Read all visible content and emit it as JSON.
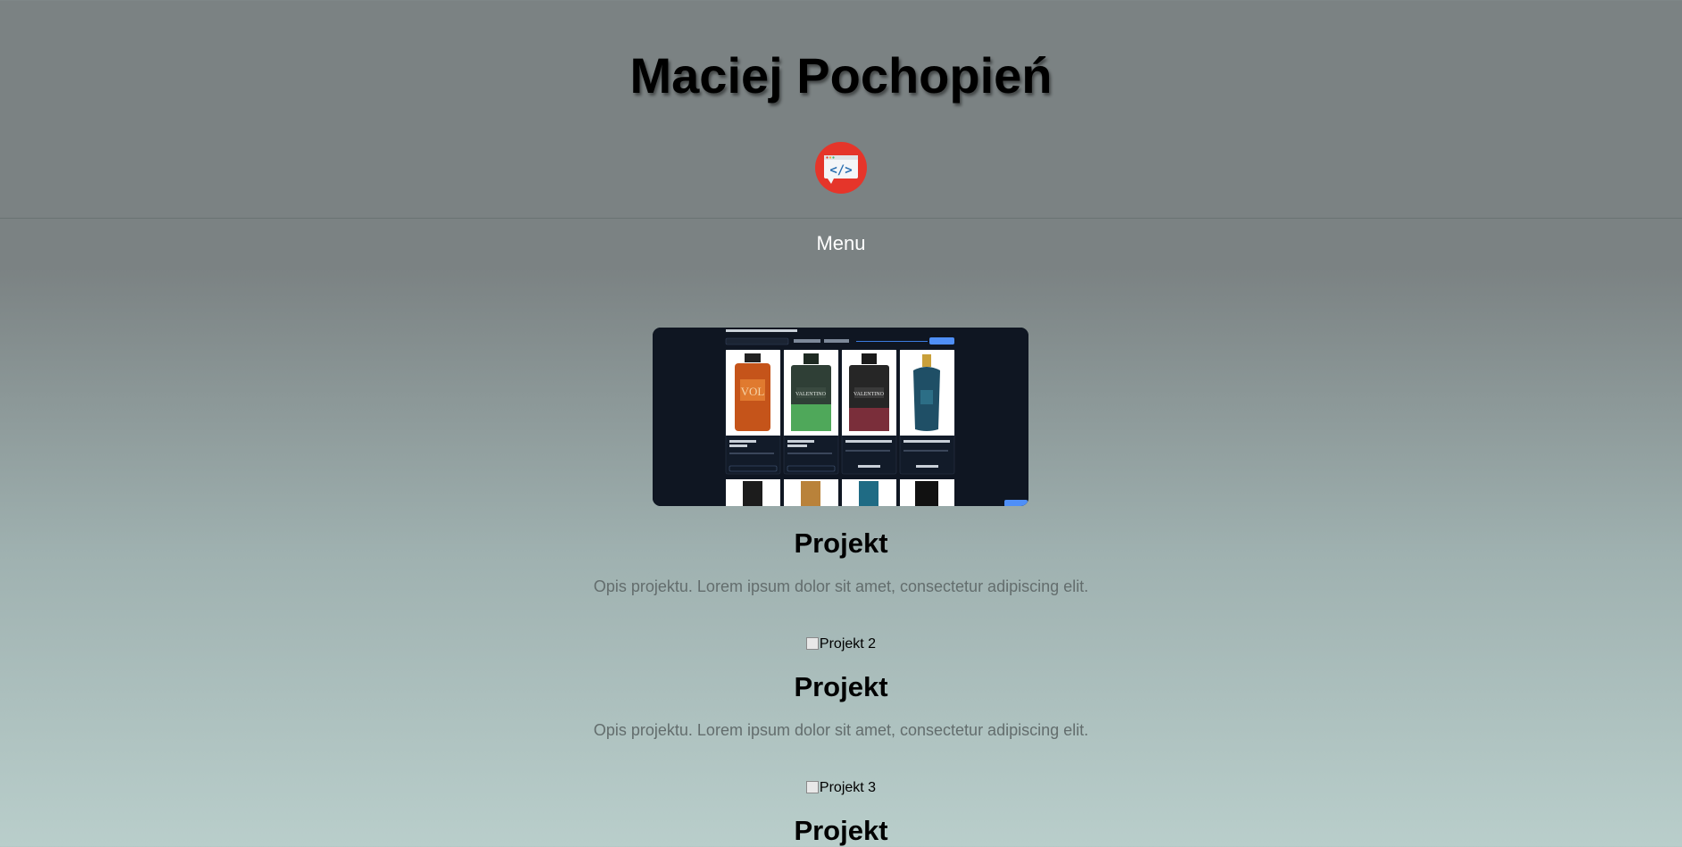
{
  "header": {
    "title": "Maciej Pochopień",
    "logo_icon": "code-window-icon",
    "accent_color": "#e5352a"
  },
  "nav": {
    "menu_label": "Menu"
  },
  "projects": [
    {
      "image_alt": "",
      "title": "Projekt",
      "description": "Opis projektu. Lorem ipsum dolor sit amet, consectetur adipiscing elit."
    },
    {
      "image_alt": "Projekt 2",
      "title": "Projekt",
      "description": "Opis projektu. Lorem ipsum dolor sit amet, consectetur adipiscing elit."
    },
    {
      "image_alt": "Projekt 3",
      "title": "Projekt"
    }
  ]
}
